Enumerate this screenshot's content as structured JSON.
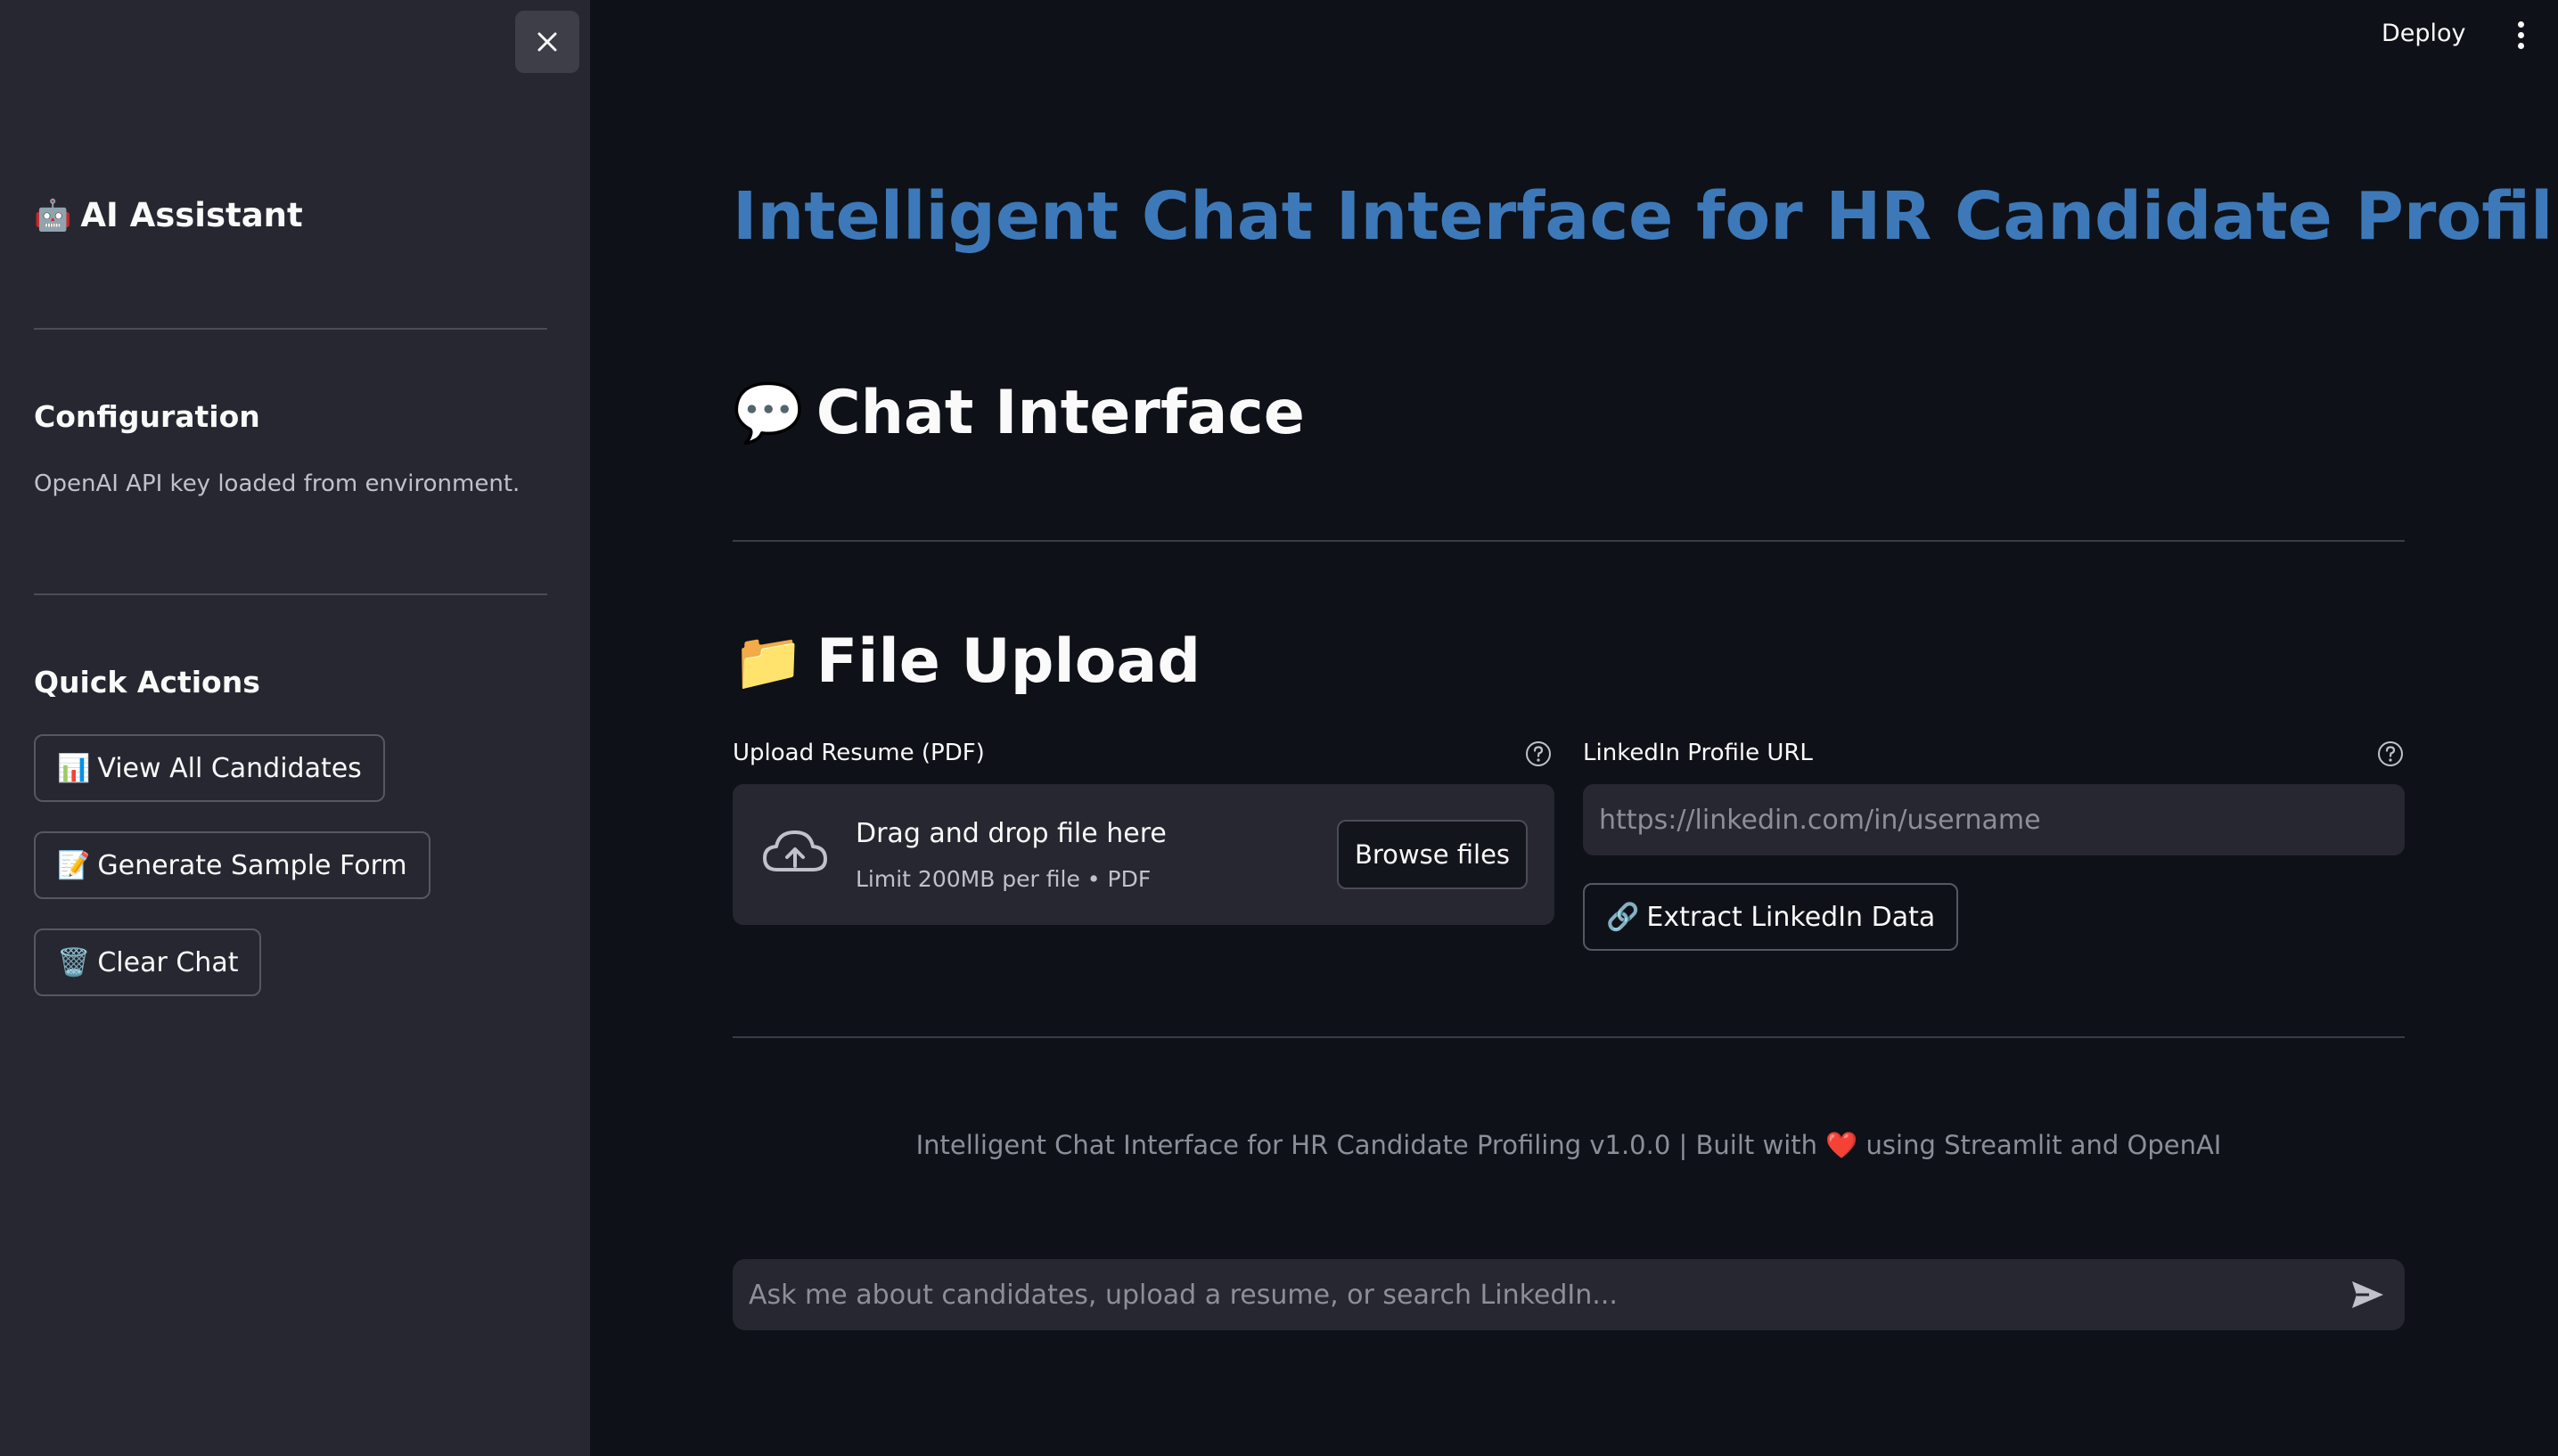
{
  "sidebar": {
    "title_emoji": "🤖",
    "title": "AI Assistant",
    "config_heading": "Configuration",
    "config_caption": "OpenAI API key loaded from environment.",
    "quick_actions_heading": "Quick Actions",
    "buttons": [
      {
        "emoji": "📊",
        "label": "View All Candidates"
      },
      {
        "emoji": "📝",
        "label": "Generate Sample Form"
      },
      {
        "emoji": "🗑️",
        "label": "Clear Chat"
      }
    ]
  },
  "topbar": {
    "deploy_label": "Deploy"
  },
  "main": {
    "title": "Intelligent Chat Interface for HR Candidate Profiling",
    "chat_section": {
      "emoji": "💬",
      "heading": "Chat Interface"
    },
    "upload_section": {
      "emoji": "📁",
      "heading": "File Upload"
    },
    "resume": {
      "label": "Upload Resume (PDF)",
      "dropzone_text": "Drag and drop file here",
      "dropzone_limit": "Limit 200MB per file • PDF",
      "browse_label": "Browse files"
    },
    "linkedin": {
      "label": "LinkedIn Profile URL",
      "placeholder": "https://linkedin.com/in/username",
      "value": "",
      "extract_emoji": "🔗",
      "extract_label": "Extract LinkedIn Data"
    },
    "footer": {
      "prefix": "Intelligent Chat Interface for HR Candidate Profiling v1.0.0 | Built with",
      "heart": "❤️",
      "suffix": "using Streamlit and OpenAI"
    },
    "chat_input": {
      "placeholder": "Ask me about candidates, upload a resume, or search LinkedIn...",
      "value": ""
    }
  },
  "colors": {
    "background": "#0e1117",
    "sidebar": "#262730",
    "title_accent": "#3d79b8",
    "text": "#fafafa",
    "muted": "#8c8f99"
  }
}
